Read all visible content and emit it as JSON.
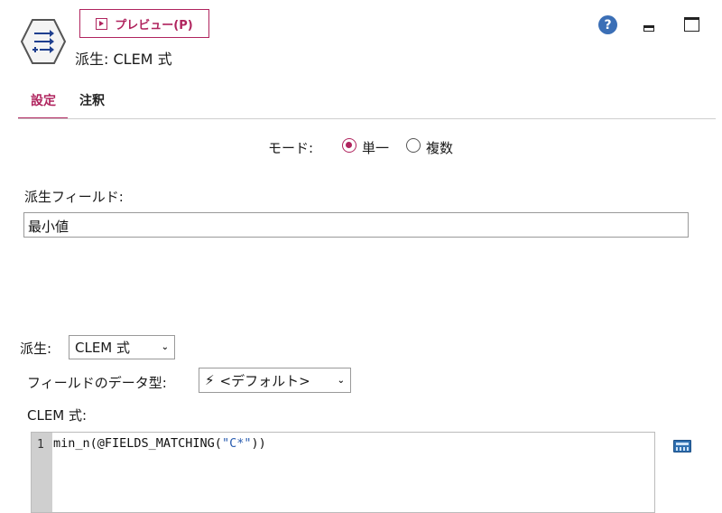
{
  "header": {
    "preview_label": "プレビュー(P)",
    "node_title": "派生: CLEM 式",
    "help_glyph": "?",
    "icons": [
      "derive-node-icon",
      "play-icon",
      "help-icon",
      "minimize-icon",
      "maximize-icon"
    ]
  },
  "tabs": [
    {
      "label": "設定",
      "active": true
    },
    {
      "label": "注釈",
      "active": false
    }
  ],
  "mode": {
    "label": "モード:",
    "options": [
      {
        "label": "単一",
        "checked": true
      },
      {
        "label": "複数",
        "checked": false
      }
    ]
  },
  "derive_field": {
    "label": "派生フィールド:",
    "value": "最小値"
  },
  "derive_as": {
    "label": "派生:",
    "selected": "CLEM 式"
  },
  "field_type": {
    "label": "フィールドのデータ型:",
    "selected": "<デフォルト>"
  },
  "clem": {
    "label": "CLEM 式:",
    "line_number": "1",
    "code_prefix": "min_n(@FIELDS_MATCHING(",
    "code_string": "\"C*\"",
    "code_suffix": "))"
  },
  "colors": {
    "accent": "#b0245e",
    "help": "#3b6fb6",
    "string_token": "#2a5db0"
  }
}
